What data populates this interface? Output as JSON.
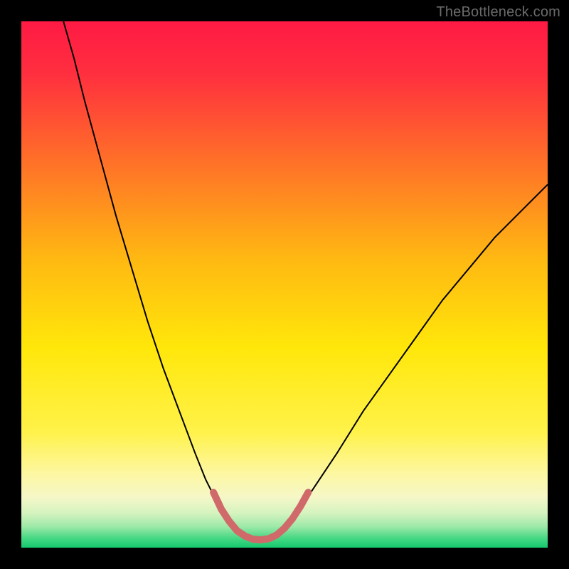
{
  "watermark": "TheBottleneck.com",
  "chart_data": {
    "type": "line",
    "title": "",
    "xlabel": "",
    "ylabel": "",
    "xlim": [
      0,
      100
    ],
    "ylim": [
      0,
      100
    ],
    "grid": false,
    "legend": false,
    "gradient_stops": [
      {
        "offset": 0.0,
        "color": "#ff1a44"
      },
      {
        "offset": 0.1,
        "color": "#ff2f3f"
      },
      {
        "offset": 0.25,
        "color": "#ff6a2a"
      },
      {
        "offset": 0.45,
        "color": "#ffb812"
      },
      {
        "offset": 0.62,
        "color": "#ffe70a"
      },
      {
        "offset": 0.78,
        "color": "#fff24a"
      },
      {
        "offset": 0.86,
        "color": "#fdf7a2"
      },
      {
        "offset": 0.905,
        "color": "#f5f7c8"
      },
      {
        "offset": 0.935,
        "color": "#d4f3bf"
      },
      {
        "offset": 0.96,
        "color": "#9de9a8"
      },
      {
        "offset": 0.982,
        "color": "#46d884"
      },
      {
        "offset": 1.0,
        "color": "#14c96e"
      }
    ],
    "series": [
      {
        "name": "bottleneck-curve",
        "stroke": "#000000",
        "stroke_width": 2,
        "points": [
          {
            "x": 8,
            "y": 100
          },
          {
            "x": 10,
            "y": 93
          },
          {
            "x": 12,
            "y": 85
          },
          {
            "x": 15,
            "y": 74
          },
          {
            "x": 18,
            "y": 63
          },
          {
            "x": 21,
            "y": 53
          },
          {
            "x": 24,
            "y": 43
          },
          {
            "x": 27,
            "y": 34
          },
          {
            "x": 30,
            "y": 26
          },
          {
            "x": 33,
            "y": 18
          },
          {
            "x": 35,
            "y": 13
          },
          {
            "x": 37,
            "y": 9
          },
          {
            "x": 39,
            "y": 5.5
          },
          {
            "x": 41,
            "y": 3.2
          },
          {
            "x": 43,
            "y": 2.0
          },
          {
            "x": 45,
            "y": 1.5
          },
          {
            "x": 47,
            "y": 1.6
          },
          {
            "x": 49,
            "y": 2.5
          },
          {
            "x": 51,
            "y": 4.5
          },
          {
            "x": 53,
            "y": 7.5
          },
          {
            "x": 56,
            "y": 12
          },
          {
            "x": 60,
            "y": 18
          },
          {
            "x": 65,
            "y": 26
          },
          {
            "x": 70,
            "y": 33
          },
          {
            "x": 75,
            "y": 40
          },
          {
            "x": 80,
            "y": 47
          },
          {
            "x": 85,
            "y": 53
          },
          {
            "x": 90,
            "y": 59
          },
          {
            "x": 95,
            "y": 64
          },
          {
            "x": 100,
            "y": 69
          }
        ]
      },
      {
        "name": "optimal-zone-marker",
        "stroke": "#d06a6a",
        "stroke_width": 10,
        "linecap": "round",
        "points": [
          {
            "x": 36.5,
            "y": 10.5
          },
          {
            "x": 38.0,
            "y": 7.3
          },
          {
            "x": 39.5,
            "y": 5.0
          },
          {
            "x": 41.0,
            "y": 3.2
          },
          {
            "x": 42.5,
            "y": 2.2
          },
          {
            "x": 44.0,
            "y": 1.6
          },
          {
            "x": 45.5,
            "y": 1.5
          },
          {
            "x": 47.0,
            "y": 1.7
          },
          {
            "x": 48.5,
            "y": 2.4
          },
          {
            "x": 50.0,
            "y": 3.7
          },
          {
            "x": 51.5,
            "y": 5.5
          },
          {
            "x": 53.0,
            "y": 7.8
          },
          {
            "x": 54.5,
            "y": 10.5
          }
        ]
      }
    ]
  }
}
